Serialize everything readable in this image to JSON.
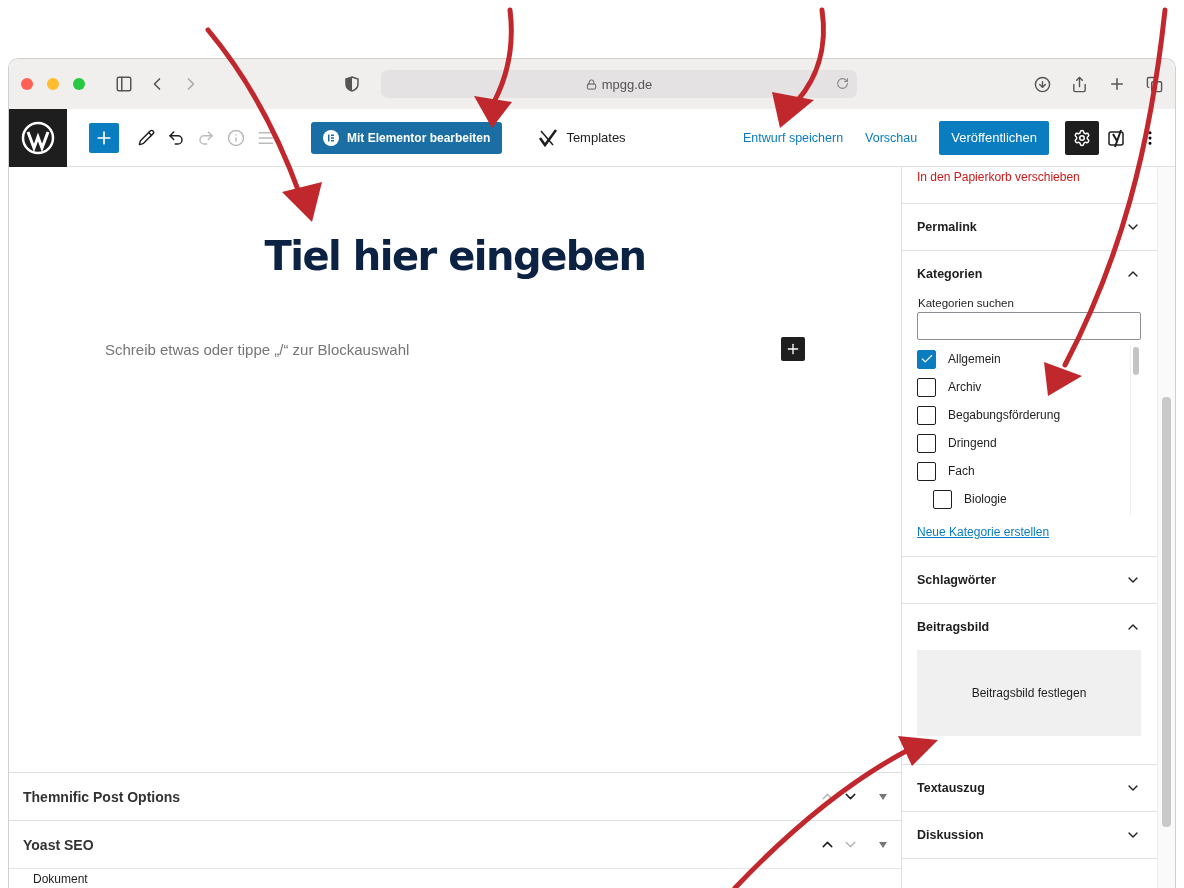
{
  "browser": {
    "url": "mpgg.de"
  },
  "toolbar": {
    "elementor_button": "Mit Elementor bearbeiten",
    "templates": "Templates",
    "save_draft": "Entwurf speichern",
    "preview": "Vorschau",
    "publish": "Veröffentlichen",
    "settings_active": true
  },
  "editor": {
    "title_placeholder": "Tiel hier eingeben",
    "block_placeholder": "Schreib etwas oder tippe „/“ zur Blockauswahl"
  },
  "meta_boxes": [
    {
      "title": "Themnific Post Options"
    },
    {
      "title": "Yoast SEO"
    }
  ],
  "status_bar": "Dokument",
  "sidebar": {
    "trash_link": "In den Papierkorb verschieben",
    "panels": [
      {
        "kind": "plain",
        "title": "Permalink",
        "expanded": false
      },
      {
        "kind": "categories",
        "title": "Kategorien",
        "expanded": true,
        "search_label": "Kategorien suchen",
        "add_link": "Neue Kategorie erstellen",
        "categories": [
          {
            "label": "Allgemein",
            "checked": true
          },
          {
            "label": "Archiv",
            "checked": false
          },
          {
            "label": "Begabungsförderung",
            "checked": false
          },
          {
            "label": "Dringend",
            "checked": false
          },
          {
            "label": "Fach",
            "checked": false,
            "children": [
              {
                "label": "Biologie",
                "checked": false
              }
            ]
          }
        ]
      },
      {
        "kind": "plain",
        "title": "Schlagwörter",
        "expanded": false
      },
      {
        "kind": "image",
        "title": "Beitragsbild",
        "expanded": true,
        "button": "Beitragsbild festlegen"
      },
      {
        "kind": "plain",
        "title": "Textauszug",
        "expanded": false
      },
      {
        "kind": "plain",
        "title": "Diskussion",
        "expanded": false
      }
    ]
  }
}
